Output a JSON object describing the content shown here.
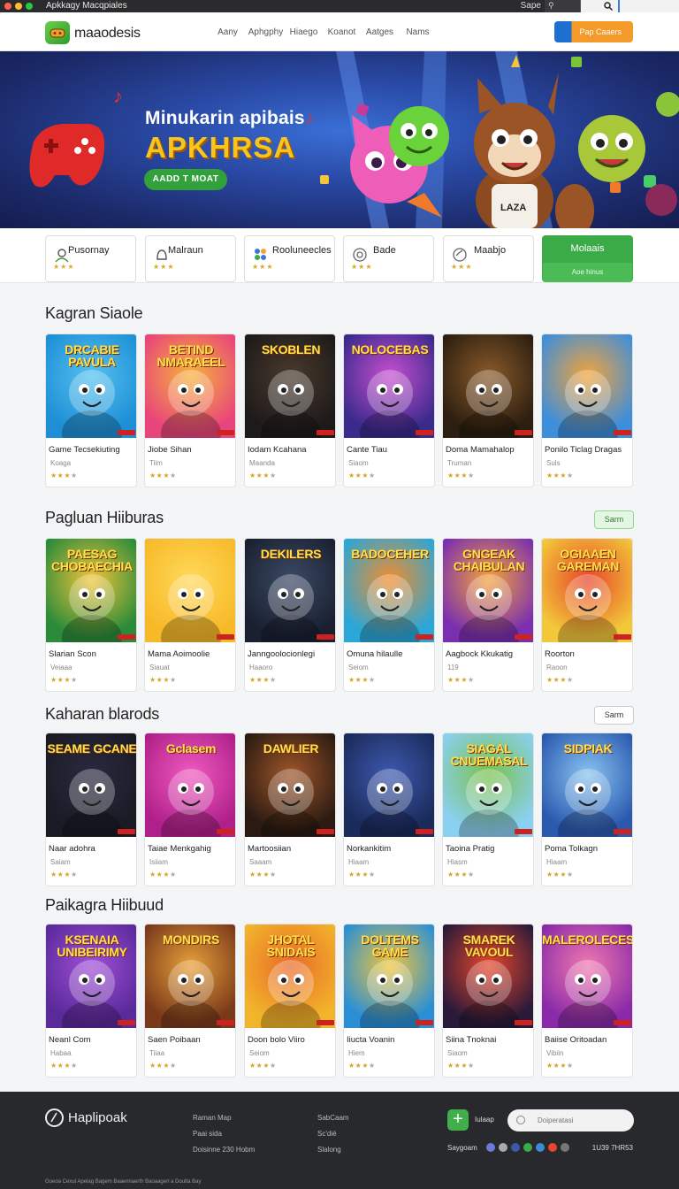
{
  "window": {
    "title": "Apkkagy Macqpiales",
    "right_label": "Sape"
  },
  "nav": {
    "brand": "maaodesis",
    "links": [
      "Aany",
      "Aphgphy",
      "Hiaego",
      "Koanot",
      "Aatges",
      "Nams"
    ],
    "cta": "Pap Caaers"
  },
  "hero": {
    "subtitle": "Minukarin apibais",
    "title": "APKHRSA",
    "button": "AADD T MOAT"
  },
  "categories": [
    {
      "label": "Pusornay",
      "stars": "★★★"
    },
    {
      "label": "Malraun",
      "stars": "★★★"
    },
    {
      "label": "Rooluneecles",
      "stars": "★★★"
    },
    {
      "label": "Bade",
      "stars": "★★★"
    },
    {
      "label": "Maabjo",
      "stars": "★★★"
    },
    {
      "label": "Molaais",
      "sublabel": "Aoe hinus"
    }
  ],
  "sections": [
    {
      "title": "Kagran Siaole",
      "action": "",
      "cards": [
        {
          "name": "Game Tecsekiuting",
          "sub": "Koaga",
          "art": "DRCABIE PAVULA",
          "c1": "#1e8fd6",
          "c2": "#55c1f0",
          "stars": 3
        },
        {
          "name": "Jiobe Sihan",
          "sub": "Tiim",
          "art": "BETIND NMARAEEL",
          "c1": "#e8457a",
          "c2": "#f7b33c",
          "stars": 3
        },
        {
          "name": "Iodam Kcahana",
          "sub": "Maanda",
          "art": "SKOBLEN",
          "c1": "#1d1a1a",
          "c2": "#4a3a2c",
          "stars": 3
        },
        {
          "name": "Cante Tiau",
          "sub": "Siaom",
          "art": "NOLOCEBAS",
          "c1": "#3a2a8c",
          "c2": "#c84fd0",
          "stars": 3
        },
        {
          "name": "Doma Mamahalop",
          "sub": "Truman",
          "art": "",
          "c1": "#2c1e10",
          "c2": "#8a5a2a",
          "stars": 3
        },
        {
          "name": "Ponilo Ticlag Dragas",
          "sub": "Suls",
          "art": "",
          "c1": "#3e8edb",
          "c2": "#f2a33a",
          "stars": 3
        }
      ]
    },
    {
      "title": "Pagluan Hiiburas",
      "action": "Sarm",
      "cards": [
        {
          "name": "Slarian Scon",
          "sub": "Veiaaa",
          "art": "PAESAG CHOBAECHIA",
          "c1": "#2b8b3a",
          "c2": "#f2c53a",
          "stars": 3
        },
        {
          "name": "Mama Aoimoolie",
          "sub": "Siauat",
          "art": "",
          "c1": "#f7b928",
          "c2": "#ffd95a",
          "stars": 3
        },
        {
          "name": "Janngoolocionlegi",
          "sub": "Haaoro",
          "art": "DEKILERS",
          "c1": "#1a2030",
          "c2": "#3b4a66",
          "stars": 3
        },
        {
          "name": "Omuna hilaulle",
          "sub": "Seiom",
          "art": "BADOCEHER",
          "c1": "#2aa7d8",
          "c2": "#f28c2a",
          "stars": 3
        },
        {
          "name": "Aagbock Kkukatig",
          "sub": "119",
          "art": "GNGEAK CHAIBULAN",
          "c1": "#7a2fb0",
          "c2": "#f5a33a",
          "stars": 3
        },
        {
          "name": "Roorton",
          "sub": "Raoon",
          "art": "OGIAAEN GAREMAN",
          "c1": "#f2c73a",
          "c2": "#e8452a",
          "stars": 3
        }
      ]
    },
    {
      "title": "Kaharan blarods",
      "action": "Sarm",
      "cards": [
        {
          "name": "Naar adohra",
          "sub": "Saiam",
          "art": "SEAME GCANE",
          "c1": "#1a1a24",
          "c2": "#2a2a40",
          "stars": 3
        },
        {
          "name": "Taiae Menkgahig",
          "sub": "Isiiam",
          "art": "Gclasem",
          "c1": "#b0208a",
          "c2": "#f05ac0",
          "stars": 3
        },
        {
          "name": "Martoosiian",
          "sub": "Saaam",
          "art": "DAWLIER",
          "c1": "#2a1a12",
          "c2": "#a0562a",
          "stars": 3
        },
        {
          "name": "Norkankitim",
          "sub": "Hiaam",
          "art": "",
          "c1": "#1a2a5a",
          "c2": "#3e5ab0",
          "stars": 3
        },
        {
          "name": "Taoina Pratig",
          "sub": "Hiasm",
          "art": "SIAGAL CNUEMASAL",
          "c1": "#8ad0f0",
          "c2": "#7ac04a",
          "stars": 3
        },
        {
          "name": "Poma Tolkagn",
          "sub": "Hiaam",
          "art": "SIDPIAK",
          "c1": "#2a5ab0",
          "c2": "#8ac4f0",
          "stars": 3
        }
      ]
    },
    {
      "title": "Paikagra Hiibuud",
      "action": "",
      "cards": [
        {
          "name": "Neanl Com",
          "sub": "Habaa",
          "art": "KSENAIA UNIBEIRIMY",
          "c1": "#5a2a9a",
          "c2": "#a04fd8",
          "stars": 3
        },
        {
          "name": "Saen Poibaan",
          "sub": "Tiiaa",
          "art": "MONDIRS",
          "c1": "#7a3a1a",
          "c2": "#e8a03a",
          "stars": 3
        },
        {
          "name": "Doon bolo Viiro",
          "sub": "Seiom",
          "art": "JHOTAL SNIDAIS",
          "c1": "#f2b42a",
          "c2": "#e86a2a",
          "stars": 3
        },
        {
          "name": "Iiucta Voanin",
          "sub": "Hiem",
          "art": "DOLTEMS GAME",
          "c1": "#2a8fd6",
          "c2": "#f2c53a",
          "stars": 3
        },
        {
          "name": "Siina Tnoknai",
          "sub": "Siaom",
          "art": "SMAREK VAVOUL",
          "c1": "#2a1a3a",
          "c2": "#e8452a",
          "stars": 3
        },
        {
          "name": "Baiise Oritoadan",
          "sub": "Vibiin",
          "art": "MALEROLECES",
          "c1": "#8a2aa8",
          "c2": "#f27ab0",
          "stars": 3
        }
      ]
    }
  ],
  "footer": {
    "brand": "Haplipoak",
    "col1": [
      "Raman Map",
      "Paai sida",
      "Doisinne 230 Hobm"
    ],
    "col2": [
      "SabCaam",
      "Sc'dié",
      "Slalong"
    ],
    "plus_label": "Iulaap",
    "input_placeholder": "Doiperatasi",
    "social_label": "Saygoam",
    "right_text": "1U39 7HR53",
    "copyright": "Goeoa Cexul Apelag Bagem Baaemiaerth Baoaagerl a Doulta Bay"
  },
  "colors": {
    "accent_green": "#3bab48",
    "accent_orange": "#f39a2b",
    "star": "#d4a52a",
    "hero_title": "#f7c51d"
  }
}
